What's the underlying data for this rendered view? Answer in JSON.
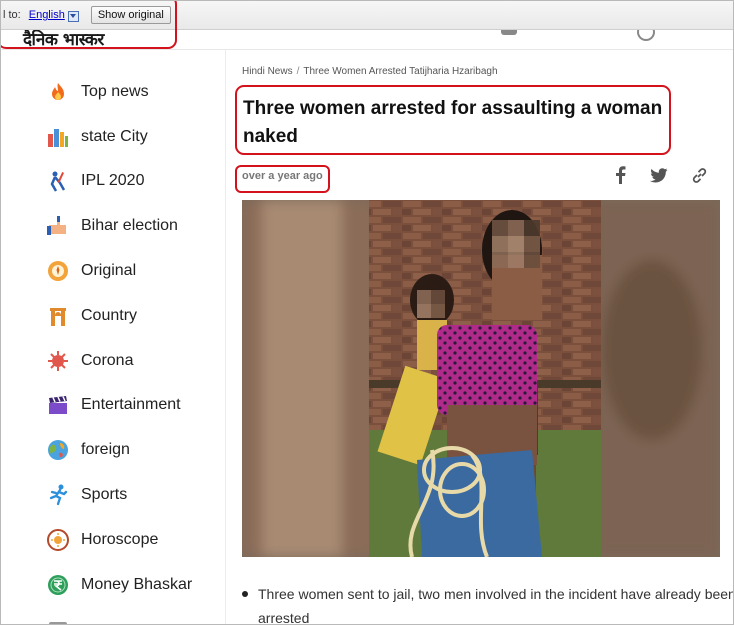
{
  "translate_bar": {
    "prefix": "l to:",
    "language": "English",
    "show_original_label": "Show original"
  },
  "site": {
    "logo_text": "दैनिक भास्कर"
  },
  "sidebar": {
    "items": [
      {
        "label": "Top news",
        "icon": "flame-icon"
      },
      {
        "label": "state City",
        "icon": "city-icon"
      },
      {
        "label": "IPL 2020",
        "icon": "cricket-icon"
      },
      {
        "label": "Bihar election",
        "icon": "voting-hand-icon"
      },
      {
        "label": "Original",
        "icon": "original-badge-icon"
      },
      {
        "label": "Country",
        "icon": "india-gate-icon"
      },
      {
        "label": "Corona",
        "icon": "virus-icon"
      },
      {
        "label": "Entertainment",
        "icon": "clapperboard-icon"
      },
      {
        "label": "foreign",
        "icon": "globe-icon"
      },
      {
        "label": "Sports",
        "icon": "runner-icon"
      },
      {
        "label": "Horoscope",
        "icon": "sun-zodiac-icon"
      },
      {
        "label": "Money Bhaskar",
        "icon": "rupee-coin-icon"
      }
    ]
  },
  "article": {
    "breadcrumb": [
      "Hindi News",
      "Three Women Arrested Tatijharia Hzaribagh"
    ],
    "headline": "Three women arrested for assaulting a woman naked",
    "timestamp": "over a year ago",
    "caption": "Three women sent to jail, two men involved in the incident have already been arrested",
    "share_icons": [
      "facebook-icon",
      "twitter-icon",
      "link-icon"
    ]
  },
  "colors": {
    "highlight_red": "#d4121b",
    "link_blue": "#0000cc"
  }
}
